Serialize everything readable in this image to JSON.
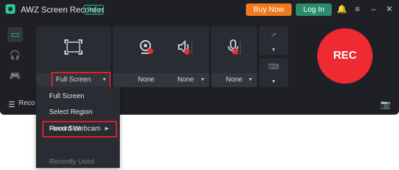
{
  "app": {
    "title": "AWZ Screen Recorder",
    "badge": "Free"
  },
  "header": {
    "buy_label": "Buy Now",
    "login_label": "Log In"
  },
  "panels": {
    "screen": {
      "value": "Full Screen"
    },
    "webcam": {
      "value": "None"
    },
    "system_audio": {
      "value": "None"
    },
    "microphone": {
      "value": "None"
    }
  },
  "rec_label": "REC",
  "bottom": {
    "label": "Reco"
  },
  "menu": {
    "items": [
      {
        "label": "Full Screen"
      },
      {
        "label": "Select Region"
      },
      {
        "label": "Fixed Size"
      },
      {
        "label": "Record Webcam"
      },
      {
        "label": "Recently Used"
      }
    ]
  },
  "colors": {
    "accent": "#2bc78d",
    "rec": "#ee2a32",
    "buy": "#f07a1d",
    "login": "#2a8c6a",
    "highlight": "#e0202a"
  },
  "icons": [
    "logo-icon",
    "bell-icon",
    "menu-icon",
    "minimize-icon",
    "close-icon",
    "monitor-icon",
    "headphones-icon",
    "gamepad-icon",
    "screen-region-icon",
    "webcam-icon",
    "speaker-icon",
    "microphone-icon",
    "cursor-icon",
    "keyboard-icon",
    "list-icon",
    "camera-icon"
  ]
}
